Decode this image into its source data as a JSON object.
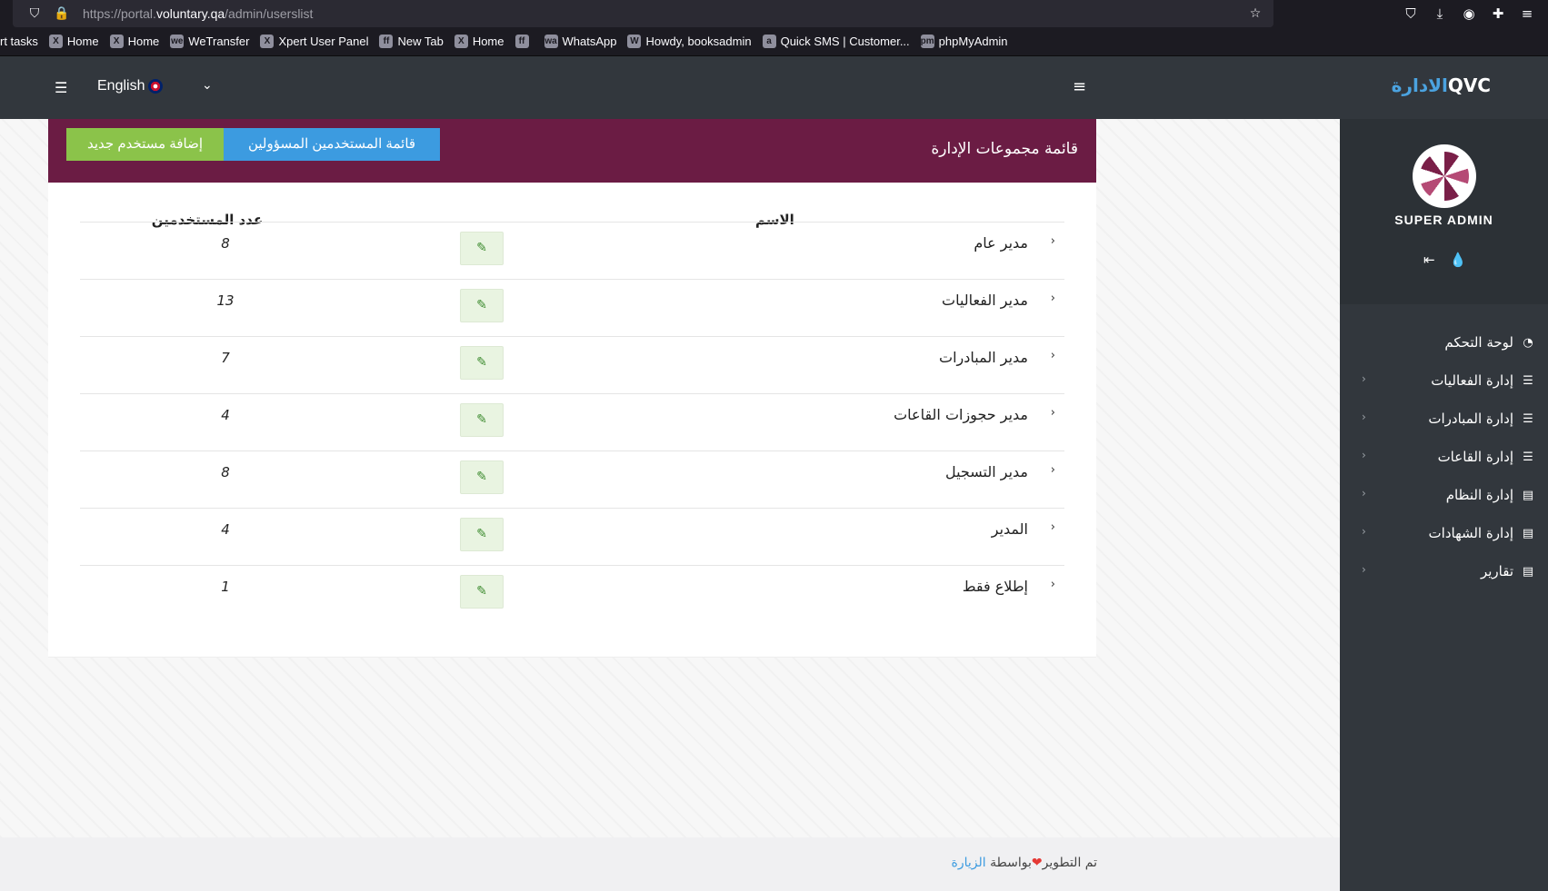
{
  "browser": {
    "url_prefix": "https://portal.",
    "url_domain": "voluntary.qa",
    "url_path": "/admin/userslist",
    "bookmarks": [
      {
        "label": "rt tasks",
        "icon": ""
      },
      {
        "label": "Home",
        "icon": "X"
      },
      {
        "label": "Home",
        "icon": "X"
      },
      {
        "label": "WeTransfer",
        "icon": "we"
      },
      {
        "label": "Xpert User Panel",
        "icon": "X"
      },
      {
        "label": "New Tab",
        "icon": "ff"
      },
      {
        "label": "Home",
        "icon": "X"
      },
      {
        "label": "",
        "icon": "ff"
      },
      {
        "label": "WhatsApp",
        "icon": "wa"
      },
      {
        "label": "Howdy, booksadmin",
        "icon": "W"
      },
      {
        "label": "Quick SMS | Customer...",
        "icon": "a"
      },
      {
        "label": "phpMyAdmin",
        "icon": "pma"
      }
    ]
  },
  "header": {
    "language": "English",
    "brand_ar": "الادارة",
    "brand_en": "QVC"
  },
  "sidebar": {
    "role": "SUPER ADMIN",
    "items": [
      {
        "label": "لوحة التحكم",
        "icon": "dashboard-icon",
        "has_sub": false
      },
      {
        "label": "إدارة الفعاليات",
        "icon": "list-icon",
        "has_sub": true
      },
      {
        "label": "إدارة المبادرات",
        "icon": "list-icon",
        "has_sub": true
      },
      {
        "label": "إدارة القاعات",
        "icon": "list-icon",
        "has_sub": true
      },
      {
        "label": "إدارة النظام",
        "icon": "server-icon",
        "has_sub": true
      },
      {
        "label": "إدارة الشهادات",
        "icon": "server-icon",
        "has_sub": true
      },
      {
        "label": "تقارير",
        "icon": "server-icon",
        "has_sub": true
      }
    ]
  },
  "panel": {
    "title": "قائمة مجموعات الإدارة",
    "btn_add": "إضافة مستخدم جديد",
    "btn_list": "قائمة المستخدمين المسؤولين",
    "col_name": "الاسم",
    "col_count": "عدد المستخدمين",
    "rows": [
      {
        "name": "مدير عام",
        "count": "8"
      },
      {
        "name": "مدير الفعاليات",
        "count": "13"
      },
      {
        "name": "مدير المبادرات",
        "count": "7"
      },
      {
        "name": "مدير حجوزات القاعات",
        "count": "4"
      },
      {
        "name": "مدير التسجيل",
        "count": "8"
      },
      {
        "name": "المدير",
        "count": "4"
      },
      {
        "name": "إطلاع فقط",
        "count": "1"
      }
    ]
  },
  "footer": {
    "text_before": "تم التطوير",
    "text_by": "بواسطة",
    "link": "الزيارة"
  }
}
